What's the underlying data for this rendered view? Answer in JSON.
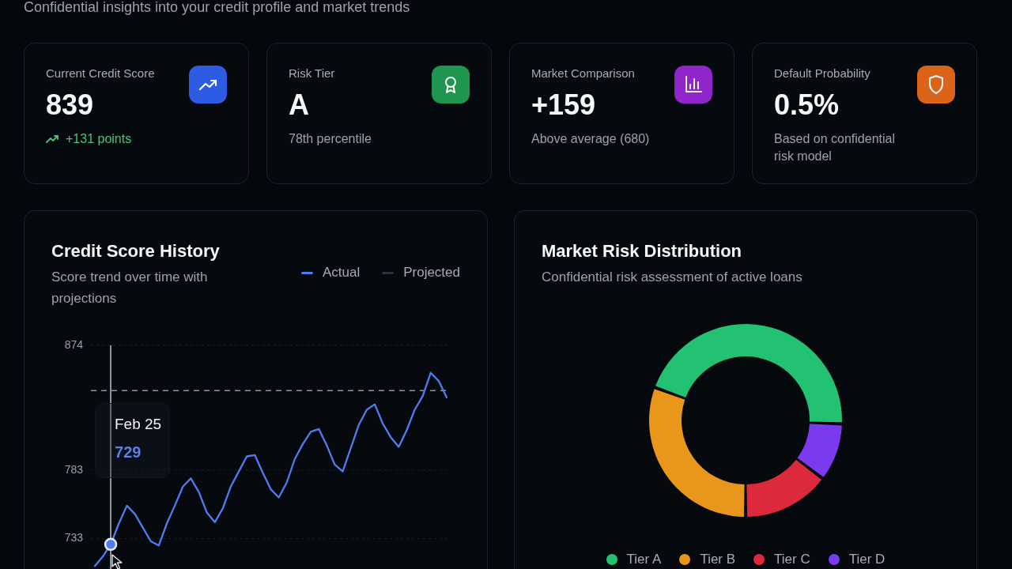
{
  "header": {
    "subtitle": "Confidential insights into your credit profile and market trends"
  },
  "stats": [
    {
      "label": "Current Credit Score",
      "value": "839",
      "note": "+131 points",
      "kind": "change",
      "color": "#2d5be3"
    },
    {
      "label": "Risk Tier",
      "value": "A",
      "note": "78th percentile",
      "kind": "caption",
      "color": "#1e9650"
    },
    {
      "label": "Market Comparison",
      "value": "+159",
      "note": "Above average (680)",
      "kind": "caption",
      "color": "#8f26c9"
    },
    {
      "label": "Default Probability",
      "value": "0.5%",
      "note": "Based on confidential risk model",
      "kind": "caption",
      "color": "#dc6418"
    }
  ],
  "credit_history": {
    "title": "Credit Score History",
    "subtitle": "Score trend over time with projections",
    "chart_data": {
      "type": "line",
      "ylim": [
        712,
        874
      ],
      "yticks": [
        733,
        783,
        874
      ],
      "series": [
        {
          "name": "Actual",
          "color": "#4f7cf0",
          "values": [
            713,
            720,
            729,
            744,
            757,
            751,
            741,
            731,
            728,
            744,
            757,
            771,
            777,
            767,
            752,
            745,
            755,
            771,
            782,
            793,
            794,
            781,
            769,
            763,
            774,
            791,
            802,
            811,
            813,
            801,
            787,
            782,
            799,
            816,
            827,
            831,
            817,
            807,
            800,
            812,
            827,
            837,
            854,
            848,
            836
          ]
        },
        {
          "name": "Projected",
          "color": "#2c333d"
        }
      ],
      "ref_lines": [
        {
          "axis": "y",
          "value": 841
        }
      ]
    },
    "tooltip": {
      "date": "Feb 25",
      "value": "729",
      "level": 0.045
    }
  },
  "market_risk": {
    "title": "Market Risk Distribution",
    "subtitle": "Confidential risk assessment of active loans",
    "legend": [
      {
        "label": "Tier A",
        "color": "#22c272"
      },
      {
        "label": "Tier B",
        "color": "#e8971a"
      },
      {
        "label": "Tier C",
        "color": "#dc2a3c"
      },
      {
        "label": "Tier D",
        "color": "#7c3aed"
      }
    ]
  }
}
